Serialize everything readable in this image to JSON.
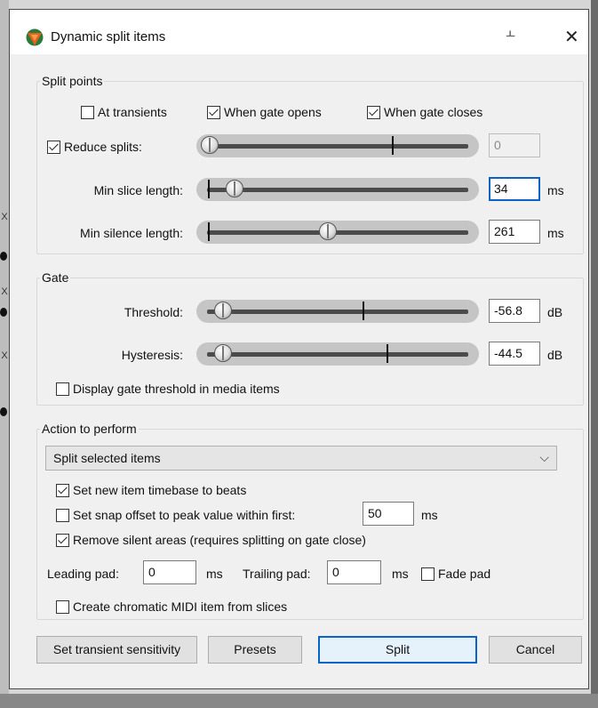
{
  "dialog": {
    "title": "Dynamic split items"
  },
  "split_points": {
    "group_label": "Split points",
    "at_transients": {
      "label": "At transients",
      "checked": false
    },
    "when_gate_opens": {
      "label": "When gate opens",
      "checked": true
    },
    "when_gate_closes": {
      "label": "When gate closes",
      "checked": true
    },
    "reduce_splits": {
      "label": "Reduce splits:",
      "checked": true,
      "value": "0",
      "level": 0.0
    },
    "min_slice": {
      "label": "Min slice length:",
      "value": "34",
      "unit": "ms"
    },
    "min_silence": {
      "label": "Min silence length:",
      "value": "261",
      "unit": "ms"
    }
  },
  "gate": {
    "group_label": "Gate",
    "threshold": {
      "label": "Threshold:",
      "value": "-56.8",
      "unit": "dB"
    },
    "hysteresis": {
      "label": "Hysteresis:",
      "value": "-44.5",
      "unit": "dB"
    },
    "display_threshold": {
      "label": "Display gate threshold in media items",
      "checked": false
    }
  },
  "action": {
    "group_label": "Action to perform",
    "selected": "Split selected items",
    "set_timebase": {
      "label": "Set new item timebase to beats",
      "checked": true
    },
    "snap_offset": {
      "label": "Set snap offset to peak value within first:",
      "checked": false,
      "value": "50",
      "unit": "ms"
    },
    "remove_silent": {
      "label": "Remove silent areas (requires splitting on gate close)",
      "checked": true
    },
    "leading_pad": {
      "label": "Leading pad:",
      "value": "0",
      "unit": "ms"
    },
    "trailing_pad": {
      "label": "Trailing pad:",
      "value": "0",
      "unit": "ms"
    },
    "fade_pad": {
      "label": "Fade pad",
      "checked": false
    },
    "chromatic_midi": {
      "label": "Create chromatic MIDI item from slices",
      "checked": false
    }
  },
  "buttons": {
    "transient_sensitivity": "Set transient sensitivity",
    "presets": "Presets",
    "split": "Split",
    "cancel": "Cancel"
  },
  "icons": {
    "app": "reaper-logo-icon",
    "pin": "pin-icon",
    "close": "close-icon",
    "dropdown": "chevron-down-icon"
  },
  "colors": {
    "accent": "#0a64c8",
    "logo_orange": "#e8601c",
    "logo_green": "#2a7a3a"
  }
}
